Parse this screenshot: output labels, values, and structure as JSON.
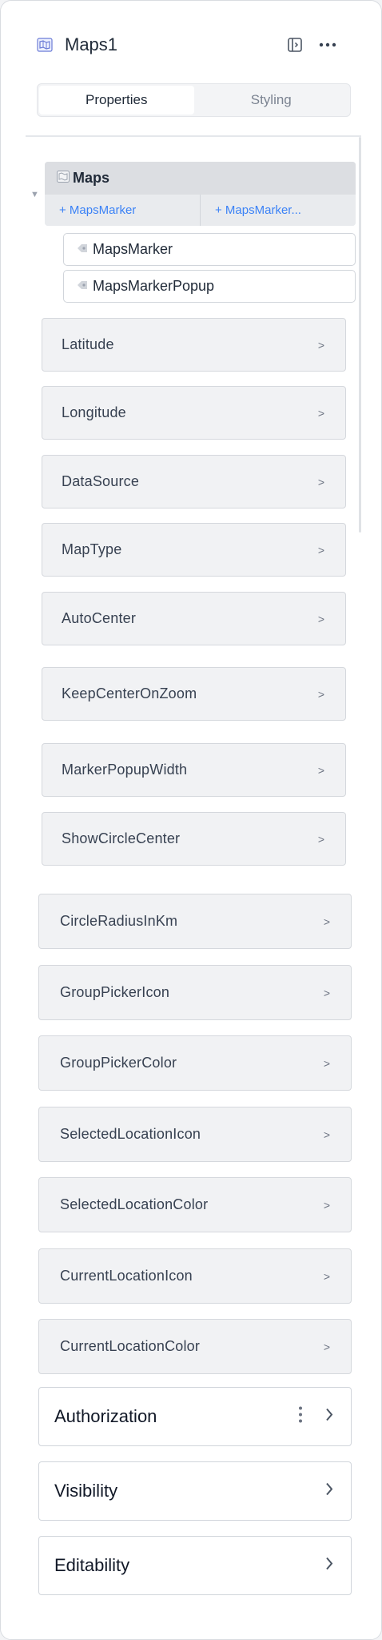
{
  "header": {
    "title": "Maps1",
    "component_icon": "map-icon",
    "panel_toggle_icon": "panel-toggle-icon",
    "more_icon": "more-horizontal-icon"
  },
  "tabs": [
    {
      "label": "Properties",
      "active": true
    },
    {
      "label": "Styling",
      "active": false
    }
  ],
  "tree": {
    "root_label": "Maps",
    "add_links": [
      "+ MapsMarker",
      "+ MapsMarker..."
    ],
    "children": [
      "MapsMarker",
      "MapsMarkerPopup"
    ]
  },
  "properties": [
    "Latitude",
    "Longitude",
    "DataSource",
    "MapType",
    "AutoCenter",
    "KeepCenterOnZoom",
    "MarkerPopupWidth",
    "ShowCircleCenter",
    "CircleRadiusInKm",
    "GroupPickerIcon",
    "GroupPickerColor",
    "SelectedLocationIcon",
    "SelectedLocationColor",
    "CurrentLocationIcon",
    "CurrentLocationColor"
  ],
  "chevron": ">",
  "sections": [
    {
      "label": "Authorization",
      "has_menu": true
    },
    {
      "label": "Visibility",
      "has_menu": false
    },
    {
      "label": "Editability",
      "has_menu": false
    }
  ],
  "colors": {
    "link": "#3b82f6",
    "row_bg": "#f1f2f4"
  }
}
